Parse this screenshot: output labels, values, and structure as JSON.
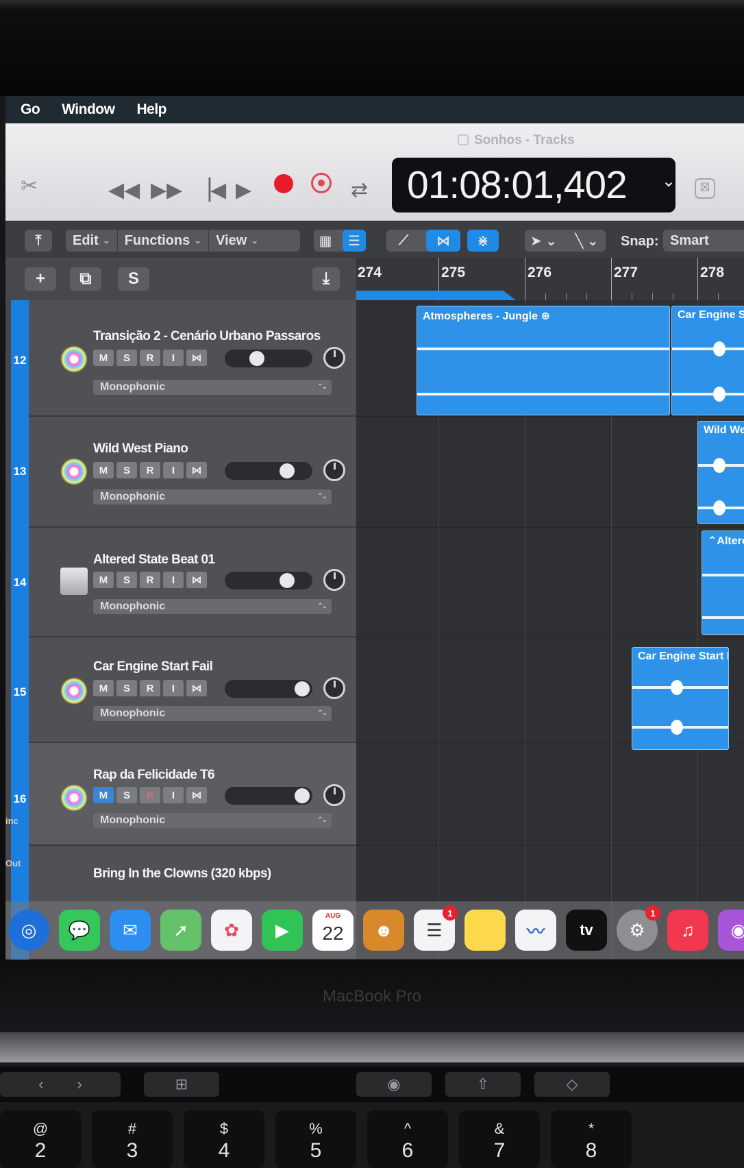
{
  "menubar": {
    "items": [
      "Go",
      "Window",
      "Help"
    ]
  },
  "window": {
    "title": "Sonhos - Tracks"
  },
  "transport": {
    "scissors_icon": "scissors-icon",
    "rewind": "◀◀",
    "forward": "▶▶",
    "to_start": "▕◀",
    "play": "▶",
    "cycle": "⇄",
    "time_display": "01:08:01,402",
    "chevron": "⌄"
  },
  "toolbar": {
    "back": "⤒",
    "edit": "Edit",
    "functions": "Functions",
    "view": "View",
    "snap_label": "Snap:",
    "snap_value": "Smart"
  },
  "tracks_header": {
    "add": "+",
    "duplicate": "⧉",
    "solo": "S",
    "catch": "⤓"
  },
  "ruler": {
    "bars": [
      "274",
      "275",
      "276",
      "277",
      "278"
    ]
  },
  "tracks": [
    {
      "number": "12",
      "name": "Transição 2 - Cenário Urbano Passaros",
      "mode": "Monophonic"
    },
    {
      "number": "13",
      "name": "Wild West Piano",
      "mode": "Monophonic"
    },
    {
      "number": "14",
      "name": "Altered State Beat 01",
      "mode": "Monophonic"
    },
    {
      "number": "15",
      "name": "Car Engine Start Fail",
      "mode": "Monophonic"
    },
    {
      "number": "16",
      "name": "Rap da Felicidade T6",
      "mode": "Monophonic"
    },
    {
      "number": "",
      "name": "Bring In the Clowns (320 kbps)",
      "mode": ""
    }
  ],
  "track_buttons": {
    "m": "M",
    "s": "S",
    "r": "R",
    "i": "I",
    "x": "⋈"
  },
  "regions": [
    {
      "label": "Atmospheres - Jungle ⊕"
    },
    {
      "label": "Car Engine S"
    },
    {
      "label": "Wild We"
    },
    {
      "label": "⌃Altere"
    },
    {
      "label": "Car Engine Start F"
    }
  ],
  "left_edge": {
    "inc": "inc",
    "out": "Out"
  },
  "dock": {
    "calendar_month": "AUG",
    "calendar_day": "22",
    "reminders_badge": "1",
    "settings_badge": "1",
    "tv_label": "tv"
  },
  "laptop": {
    "brand": "MacBook Pro"
  },
  "keys": [
    {
      "top": "@",
      "bot": "2"
    },
    {
      "top": "#",
      "bot": "3"
    },
    {
      "top": "$",
      "bot": "4"
    },
    {
      "top": "%",
      "bot": "5"
    },
    {
      "top": "^",
      "bot": "6"
    },
    {
      "top": "&",
      "bot": "7"
    },
    {
      "top": "*",
      "bot": "8"
    }
  ]
}
